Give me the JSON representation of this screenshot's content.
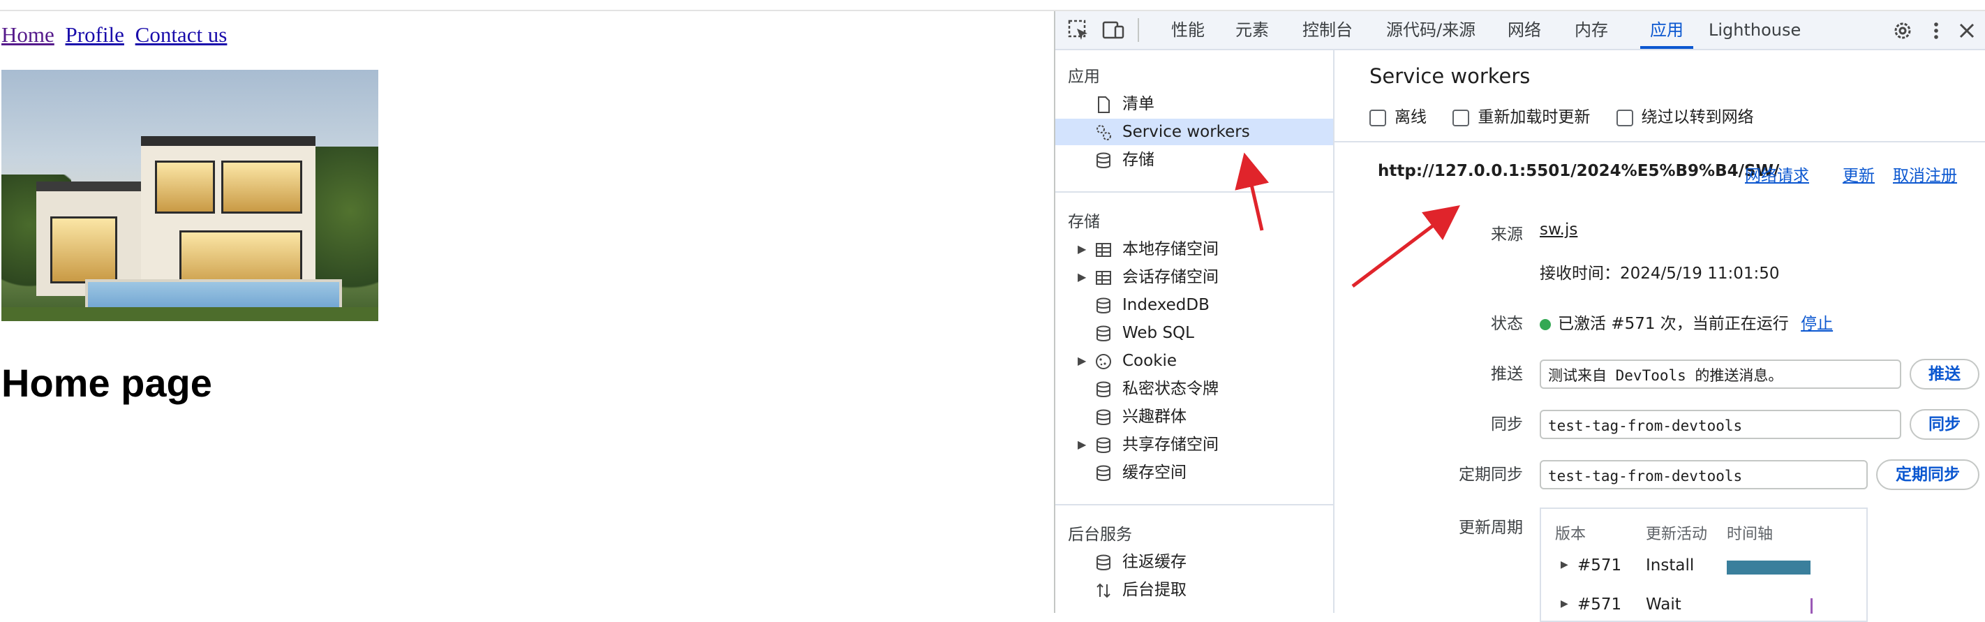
{
  "page": {
    "nav": [
      "Home",
      "Profile",
      "Contact us"
    ],
    "heading": "Home page",
    "image_alt": "modern house"
  },
  "devtools": {
    "tabs": [
      "性能",
      "元素",
      "控制台",
      "源代码/来源",
      "网络",
      "内存",
      "应用",
      "Lighthouse"
    ],
    "active_tab": "应用",
    "sidebar": {
      "app_section": "应用",
      "app_items": [
        "清单",
        "Service workers",
        "存储"
      ],
      "storage_section": "存储",
      "storage_items": [
        "本地存储空间",
        "会话存储空间",
        "IndexedDB",
        "Web SQL",
        "Cookie",
        "私密状态令牌",
        "兴趣群体",
        "共享存储空间",
        "缓存空间"
      ],
      "bg_section": "后台服务",
      "bg_items": [
        "往返缓存",
        "后台提取"
      ]
    },
    "main": {
      "title": "Service workers",
      "checkboxes": [
        "离线",
        "重新加载时更新",
        "绕过以转到网络"
      ],
      "sw_url": "http://127.0.0.1:5501/2024%E5%B9%B4/SW/",
      "actions": [
        "网络请求",
        "更新",
        "取消注册"
      ],
      "source_label": "来源",
      "source_value": "sw.js",
      "received": "接收时间：2024/5/19 11:01:50",
      "status_label": "状态",
      "status_value": "已激活 #571 次，当前正在运行",
      "status_stop": "停止",
      "push_label": "推送",
      "push_value": "测试来自 DevTools 的推送消息。",
      "push_button": "推送",
      "sync_label": "同步",
      "sync_value": "test-tag-from-devtools",
      "sync_button": "同步",
      "periodic_label": "定期同步",
      "periodic_value": "test-tag-from-devtools",
      "periodic_button": "定期同步",
      "update_cycle_label": "更新周期",
      "timeline": {
        "headers": [
          "版本",
          "更新活动",
          "时间轴"
        ],
        "rows": [
          {
            "version": "#571",
            "activity": "Install"
          },
          {
            "version": "#571",
            "activity": "Wait"
          }
        ]
      }
    },
    "colors": {
      "accent": "#0b57d0",
      "selected_bg": "#d3e3fd",
      "status_green": "#34a853",
      "arrow_red": "#e0242b"
    }
  }
}
